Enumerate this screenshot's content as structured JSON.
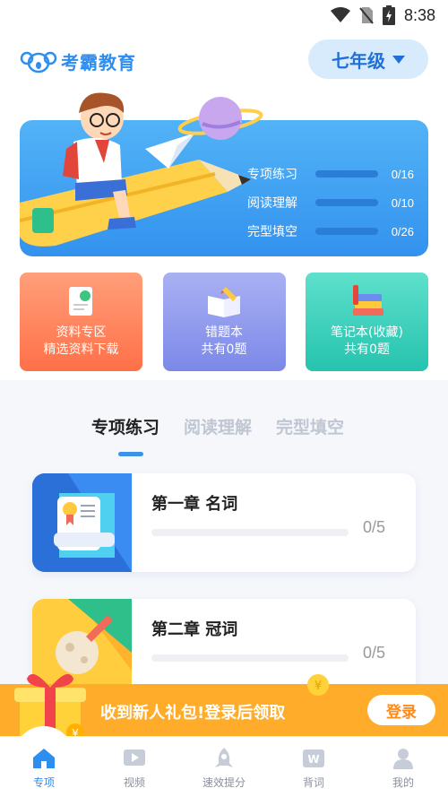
{
  "status": {
    "time": "8:38"
  },
  "app": {
    "name": "考霸教育"
  },
  "grade": {
    "selected": "七年级"
  },
  "banner": {
    "progress": [
      {
        "label": "专项练习",
        "count": "0/16"
      },
      {
        "label": "阅读理解",
        "count": "0/10"
      },
      {
        "label": "完型填空",
        "count": "0/26"
      }
    ]
  },
  "cards": [
    {
      "line1": "资料专区",
      "line2": "精选资料下载"
    },
    {
      "line1": "错题本",
      "line2": "共有0题"
    },
    {
      "line1": "笔记本(收藏)",
      "line2": "共有0题"
    }
  ],
  "tabs": [
    "专项练习",
    "阅读理解",
    "完型填空"
  ],
  "chapters": [
    {
      "title": "第一章  名词",
      "count": "0/5"
    },
    {
      "title": "第二章  冠词",
      "count": "0/5"
    }
  ],
  "gift": {
    "text": "收到新人礼包!登录后领取",
    "button": "登录"
  },
  "nav": [
    "专项",
    "视频",
    "速效提分",
    "背词",
    "我的"
  ],
  "colors": {
    "accent": "#2e8ef0",
    "gift": "#ffac2a"
  }
}
